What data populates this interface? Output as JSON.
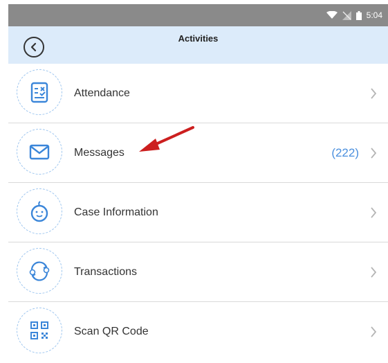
{
  "status_bar": {
    "time": "5:04"
  },
  "header": {
    "title": "Activities"
  },
  "rows": [
    {
      "label": "Attendance",
      "badge": "",
      "icon": "attendance-icon"
    },
    {
      "label": "Messages",
      "badge": "(222)",
      "icon": "envelope-icon"
    },
    {
      "label": "Case Information",
      "badge": "",
      "icon": "baby-face-icon"
    },
    {
      "label": "Transactions",
      "badge": "",
      "icon": "exchange-icon"
    },
    {
      "label": "Scan QR Code",
      "badge": "",
      "icon": "qr-code-icon"
    }
  ],
  "colors": {
    "accent": "#4a8fde",
    "header_bg": "#dcebfa",
    "annotation_arrow": "#cc1f1f"
  }
}
